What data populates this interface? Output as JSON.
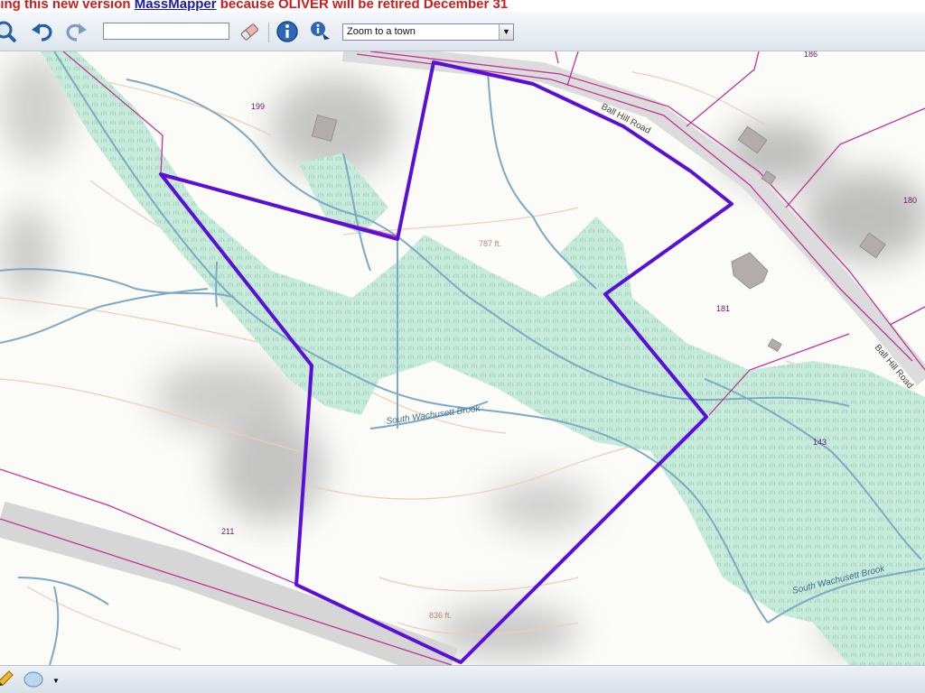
{
  "banner": {
    "lead_text": "sing this new version ",
    "link_text": "MassMapper",
    "tail_text": " because OLIVER will be retired December 31"
  },
  "toolbar": {
    "buttons": [
      {
        "name": "zoom-search-icon"
      },
      {
        "name": "undo-icon"
      },
      {
        "name": "redo-icon"
      },
      {
        "name": "eraser-icon"
      },
      {
        "name": "identify-info-icon"
      },
      {
        "name": "identify-point-icon"
      }
    ],
    "search_value": "",
    "town_select": {
      "selected": "Zoom to a town"
    }
  },
  "map": {
    "road_labels": [
      "Ball Hill Road",
      "Ball Hill Road"
    ],
    "stream_labels": [
      "South Wachusett Brook",
      "South Wachusett Brook"
    ],
    "contour_labels": [
      "787 ft.",
      "836 ft."
    ],
    "parcel_labels": [
      "199",
      "186",
      "180",
      "181",
      "143",
      "211"
    ],
    "colors": {
      "parcel_boundary": "#5a0fd8",
      "parcel_lines": "#c0329a",
      "wetland": "#b8e3cf",
      "streams": "#7ea9c5",
      "contours": "#f0cdb5",
      "road": "#d9d9d9"
    }
  },
  "bottombar": {
    "tools": [
      {
        "name": "pencil-icon"
      },
      {
        "name": "shape-icon"
      }
    ]
  }
}
